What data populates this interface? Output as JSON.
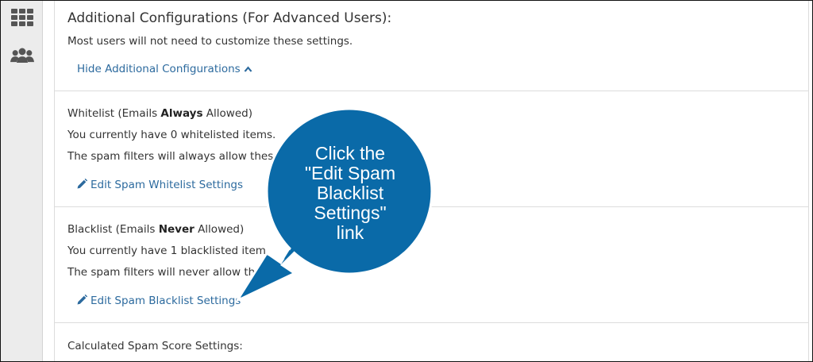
{
  "sidebar": {
    "icons": [
      "apps-grid-icon",
      "users-group-icon"
    ]
  },
  "config": {
    "title": "Additional Configurations (For Advanced Users):",
    "subtitle": "Most users will not need to customize these settings.",
    "toggle_label": "Hide Additional Configurations"
  },
  "whitelist": {
    "label_prefix": "Whitelist (Emails ",
    "label_emphasis": "Always",
    "label_suffix": " Allowed)",
    "count_text": "You currently have 0 whitelisted items.",
    "description": "The spam filters will always allow these it",
    "edit_link": "Edit Spam Whitelist Settings"
  },
  "blacklist": {
    "label_prefix": "Blacklist (Emails ",
    "label_emphasis": "Never",
    "label_suffix": " Allowed)",
    "count_text": "You currently have 1 blacklisted item",
    "description": "The spam filters will never allow the",
    "edit_link": "Edit Spam Blacklist Settings"
  },
  "score": {
    "label": "Calculated Spam Score Settings:"
  },
  "callout": {
    "lines": [
      "Click the",
      "\"Edit Spam",
      "Blacklist",
      "Settings\"",
      "link"
    ],
    "color": "#0a6aa8",
    "text_color": "#ffffff"
  },
  "colors": {
    "link": "#2c6a9e",
    "text": "#333333",
    "rail": "#ececec",
    "border": "#dcdcdc"
  }
}
